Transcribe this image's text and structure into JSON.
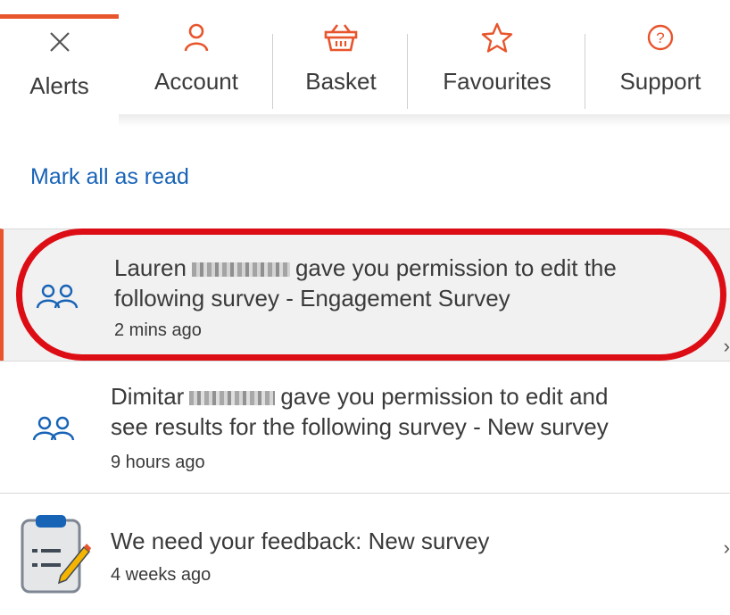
{
  "tabs": [
    {
      "label": "Alerts",
      "icon": "close-icon"
    },
    {
      "label": "Account",
      "icon": "person-icon"
    },
    {
      "label": "Basket",
      "icon": "basket-icon"
    },
    {
      "label": "Favourites",
      "icon": "star-icon"
    },
    {
      "label": "Support",
      "icon": "help-icon"
    }
  ],
  "mark_all_label": "Mark all as read",
  "alerts": [
    {
      "name_first": "Lauren",
      "line1_rest": "gave you permission to edit the",
      "line2": "following survey - Engagement Survey",
      "time": "2 mins ago",
      "icon": "users-icon"
    },
    {
      "name_first": "Dimitar",
      "line1_rest": "gave you permission to edit and",
      "line2": "see results for the following survey - New survey",
      "time": "9 hours ago",
      "icon": "users-icon"
    },
    {
      "line1": "We need your feedback: New survey",
      "time": "4 weeks ago",
      "icon": "clipboard-icon"
    }
  ],
  "colors": {
    "accent": "#e8542c",
    "link": "#1763b6",
    "highlight_ring": "#dc0d14"
  }
}
